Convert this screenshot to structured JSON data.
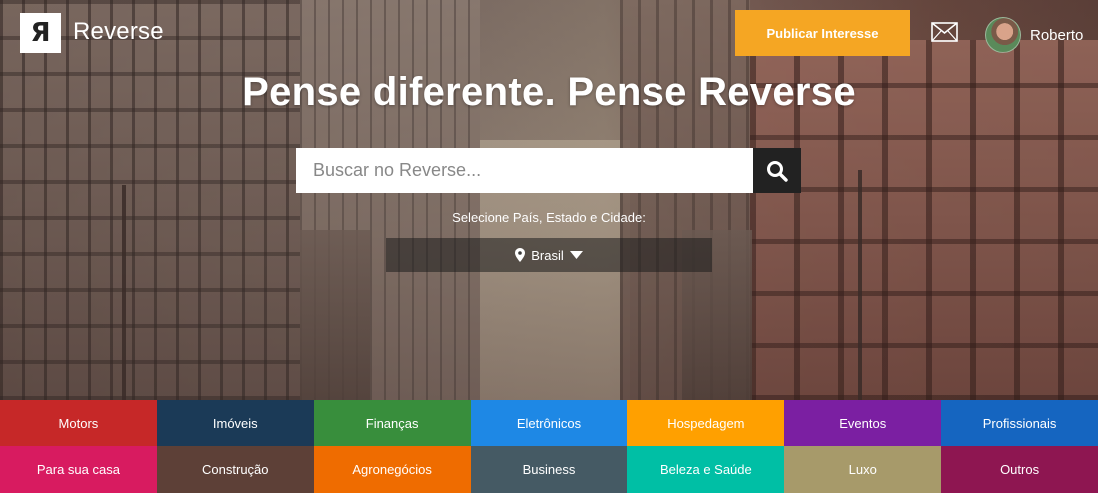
{
  "header": {
    "logo_mark": "Я",
    "logo_text": "Reverse",
    "publish_label": "Publicar Interesse",
    "mail_icon": "mail-icon",
    "user_name": "Roberto"
  },
  "hero": {
    "title": "Pense diferente. Pense Reverse",
    "search_placeholder": "Buscar no Reverse...",
    "search_icon": "search-icon",
    "location_label": "Selecione País, Estado e Cidade:",
    "location_value": "Brasil",
    "location_icon": "map-marker-icon"
  },
  "categories": [
    {
      "label": "Motors",
      "color": "#c62828"
    },
    {
      "label": "Imóveis",
      "color": "#1b3a57"
    },
    {
      "label": "Finanças",
      "color": "#388e3c"
    },
    {
      "label": "Eletrônicos",
      "color": "#1e88e5"
    },
    {
      "label": "Hospedagem",
      "color": "#ffa000"
    },
    {
      "label": "Eventos",
      "color": "#7b1fa2"
    },
    {
      "label": "Profissionais",
      "color": "#1565c0"
    },
    {
      "label": "Para sua casa",
      "color": "#d81b60"
    },
    {
      "label": "Construção",
      "color": "#5d4037"
    },
    {
      "label": "Agronegócios",
      "color": "#ef6c00"
    },
    {
      "label": "Business",
      "color": "#455a64"
    },
    {
      "label": "Beleza e Saúde",
      "color": "#00bfa5"
    },
    {
      "label": "Luxo",
      "color": "#a79a6a"
    },
    {
      "label": "Outros",
      "color": "#8e1651"
    }
  ]
}
